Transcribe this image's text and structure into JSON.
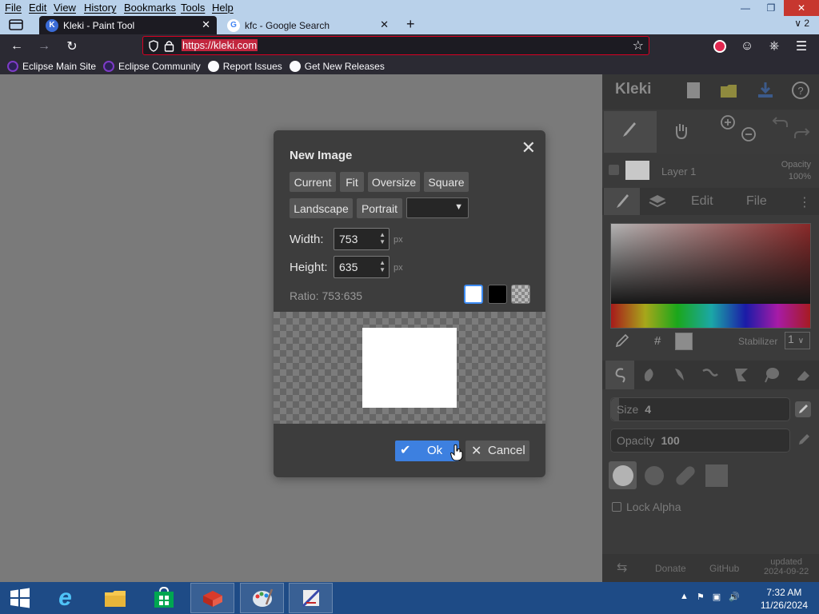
{
  "menubar": {
    "items": [
      "File",
      "Edit",
      "View",
      "History",
      "Bookmarks",
      "Tools",
      "Help"
    ]
  },
  "tabs": [
    {
      "title": "Kleki - Paint Tool",
      "active": true
    },
    {
      "title": "kfc - Google Search",
      "active": false
    }
  ],
  "navbar": {
    "url": "https://kleki.com"
  },
  "bookmarks": [
    {
      "label": "Eclipse Main Site",
      "icon": "eclipse-icon"
    },
    {
      "label": "Eclipse Community",
      "icon": "eclipse-icon"
    },
    {
      "label": "Report Issues",
      "icon": "github-icon"
    },
    {
      "label": "Get New Releases",
      "icon": "github-icon"
    }
  ],
  "panel": {
    "logo": "Kleki",
    "layer_name": "Layer 1",
    "layer_opacity_label": "Opacity",
    "layer_opacity_value": "100%",
    "tab_edit": "Edit",
    "tab_file": "File",
    "hash": "#",
    "stabilizer_label": "Stabilizer",
    "stabilizer_value": "1",
    "size_label": "Size",
    "size_value": "4",
    "opacity_label": "Opacity",
    "opacity_value": "100",
    "lock_alpha": "Lock Alpha",
    "donate": "Donate",
    "github": "GitHub",
    "updated_label": "updated",
    "updated_date": "2024-09-22"
  },
  "dialog": {
    "title": "New Image",
    "presets": [
      "Current",
      "Fit",
      "Oversize",
      "Square",
      "Landscape",
      "Portrait"
    ],
    "width_label": "Width:",
    "width_value": "753",
    "height_label": "Height:",
    "height_value": "635",
    "unit": "px",
    "ratio": "Ratio: 753:635",
    "ok_label": "Ok",
    "cancel_label": "Cancel"
  },
  "taskbar": {
    "time": "7:32 AM",
    "date": "11/26/2024"
  },
  "colors": {
    "accent": "#3d80e0",
    "titlebar": "#b9d1ea",
    "taskbar": "#1e4b86",
    "toolbar": "#2b2a33"
  }
}
